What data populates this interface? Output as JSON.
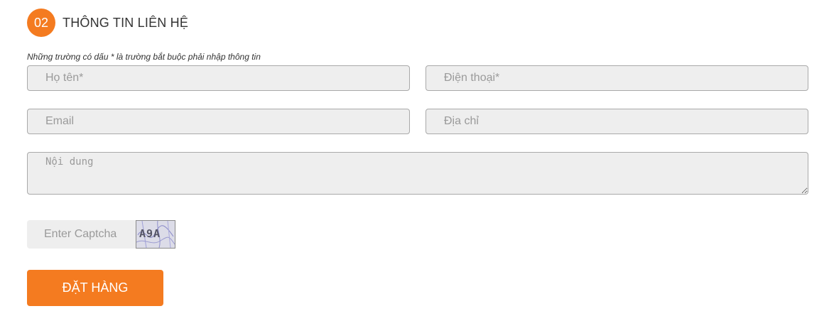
{
  "section": {
    "step_number": "02",
    "title": "THÔNG TIN LIÊN HỆ",
    "required_note": "Những trường có dấu * là trường bắt buộc phải nhập thông tin"
  },
  "form": {
    "fullname_placeholder": "Họ tên*",
    "phone_placeholder": "Điện thoại*",
    "email_placeholder": "Email",
    "address_placeholder": "Địa chỉ",
    "message_placeholder": "Nội dung",
    "captcha_placeholder": "Enter Captcha",
    "captcha_code": "A9A",
    "submit_label": "ĐẶT HÀNG"
  },
  "colors": {
    "accent": "#f47b20",
    "field_background": "#eeeeee",
    "field_border": "#a9a9a9"
  }
}
